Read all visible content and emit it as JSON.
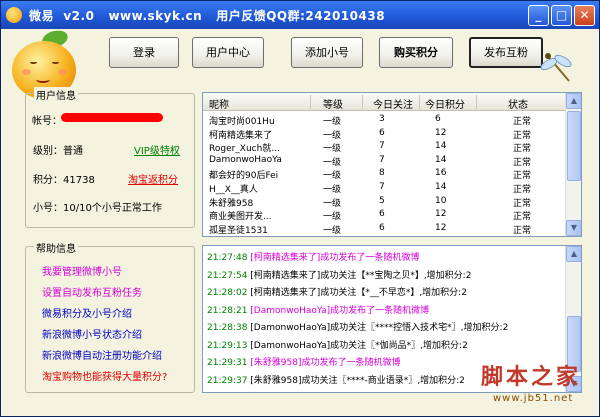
{
  "window": {
    "title": "微易  v2.0   www.skyk.cn   用户反馈QQ群:242010438",
    "minimize": "_",
    "maximize": "□",
    "close": "✕"
  },
  "toolbar": {
    "login": "登录",
    "user_center": "用户中心",
    "add_account": "添加小号",
    "buy_points": "购买积分",
    "publish_fans": "发布互粉"
  },
  "user_info": {
    "group_title": "用户信息",
    "account_label": "帐号：",
    "level_label": "级别：普通",
    "vip_link": "VIP级特权",
    "points_label": "积分：41738",
    "taobao_link": "淘宝返积分",
    "accounts_status": "小号：10/10个小号正常工作"
  },
  "help": {
    "group_title": "帮助信息",
    "items": [
      {
        "label": "我要管理微博小号",
        "color": "#d700d7"
      },
      {
        "label": "设置自动发布互粉任务",
        "color": "#d700d7"
      },
      {
        "label": "微易积分及小号介绍",
        "color": "#0000c0"
      },
      {
        "label": "新浪微博小号状态介绍",
        "color": "#0000c0"
      },
      {
        "label": "新浪微博自动注册功能介绍",
        "color": "#0000c0"
      },
      {
        "label": "淘宝购物也能获得大量积分?",
        "color": "#e00000"
      }
    ]
  },
  "table": {
    "columns": [
      "昵称",
      "等级",
      "今日关注",
      "今日积分",
      "状态"
    ],
    "rows": [
      [
        "淘宝时尚001Hu",
        "一级",
        "3",
        "6",
        "正常"
      ],
      [
        "柯南精选集来了",
        "一级",
        "6",
        "12",
        "正常"
      ],
      [
        "Roger_Xuch就...",
        "一级",
        "7",
        "14",
        "正常"
      ],
      [
        "DamonwoHaoYa",
        "一级",
        "7",
        "14",
        "正常"
      ],
      [
        "都会好的90后Fei",
        "一级",
        "8",
        "16",
        "正常"
      ],
      [
        "H__X__真人",
        "一级",
        "7",
        "14",
        "正常"
      ],
      [
        "朱舒雅958",
        "一级",
        "5",
        "10",
        "正常"
      ],
      [
        "商业美图开发...",
        "一级",
        "6",
        "12",
        "正常"
      ],
      [
        "孤星圣徒1531",
        "一级",
        "6",
        "12",
        "正常"
      ]
    ]
  },
  "log": {
    "lines": [
      {
        "time": "21:27:48",
        "msg": "[柯南精选集来了]成功发布了一条随机微博",
        "color": "#d700d7"
      },
      {
        "time": "21:27:54",
        "msg": "[柯南精选集来了]成功关注【**宝陶之贝*】,增加积分:2",
        "color": "#000000"
      },
      {
        "time": "21:28:02",
        "msg": "[柯南精选集来了]成功关注【*__不早恋*】,增加积分:2",
        "color": "#000000"
      },
      {
        "time": "21:28:21",
        "msg": "[DamonwoHaoYa]成功发布了一条随机微博",
        "color": "#d700d7"
      },
      {
        "time": "21:28:38",
        "msg": "[DamonwoHaoYa]成功关注〖****控悟入技术宅*〗,增加积分:2",
        "color": "#000000"
      },
      {
        "time": "21:29:13",
        "msg": "[DamonwoHaoYa]成功关注〖*伽尚品*〗,增加积分:2",
        "color": "#000000"
      },
      {
        "time": "21:29:31",
        "msg": "[朱舒雅958]成功发布了一条随机微博",
        "color": "#d700d7"
      },
      {
        "time": "21:29:37",
        "msg": "[朱舒雅958]成功关注〖****-商业语录*〗,增加积分:2",
        "color": "#000000"
      }
    ]
  },
  "watermark": {
    "main": "脚本之家",
    "url": "www.jb51.net"
  }
}
